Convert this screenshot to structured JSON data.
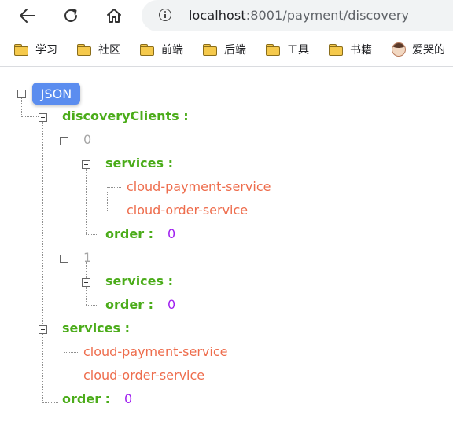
{
  "browser": {
    "url_host": "localhost",
    "url_path": ":8001/payment/discovery",
    "nav": {
      "back_icon": "arrow-left",
      "reload_icon": "reload",
      "home_icon": "home"
    }
  },
  "bookmarks": [
    {
      "label": "学习",
      "icon": "folder"
    },
    {
      "label": "社区",
      "icon": "folder"
    },
    {
      "label": "前端",
      "icon": "folder"
    },
    {
      "label": "后端",
      "icon": "folder"
    },
    {
      "label": "工具",
      "icon": "folder"
    },
    {
      "label": "书籍",
      "icon": "folder"
    },
    {
      "label": "爱哭的",
      "icon": "avatar"
    }
  ],
  "json_viewer": {
    "root_label": "JSON",
    "discovery_key": "discoveryClients :",
    "clients": [
      {
        "index": "0",
        "services_key": "services :",
        "services": [
          "cloud-payment-service",
          "cloud-order-service"
        ],
        "order_key": "order :",
        "order_value": "0"
      },
      {
        "index": "1",
        "services_key": "services :",
        "services": [],
        "order_key": "order :",
        "order_value": "0"
      }
    ],
    "services_key": "services :",
    "services": [
      "cloud-payment-service",
      "cloud-order-service"
    ],
    "order_key": "order :",
    "order_value": "0"
  },
  "colors": {
    "key": "#4bac1a",
    "string": "#ee6d4d",
    "number": "#a020f0",
    "index": "#a6a6a6",
    "badge": "#5b8def"
  }
}
